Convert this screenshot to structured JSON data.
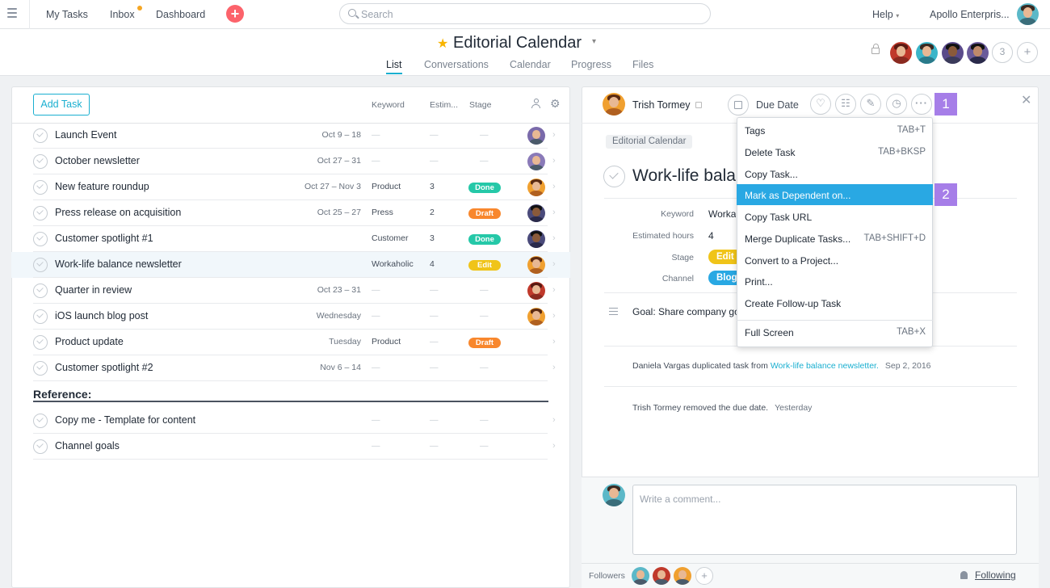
{
  "topbar": {
    "nav": [
      "My Tasks",
      "Inbox",
      "Dashboard"
    ],
    "search_placeholder": "Search",
    "help": "Help",
    "org": "Apollo Enterpris..."
  },
  "project": {
    "title": "Editorial Calendar",
    "tabs": [
      "List",
      "Conversations",
      "Calendar",
      "Progress",
      "Files"
    ],
    "member_count": "3"
  },
  "list": {
    "add_task": "Add Task",
    "columns": {
      "keyword": "Keyword",
      "estimated": "Estim...",
      "stage": "Stage"
    },
    "rows": [
      {
        "name": "Launch Event",
        "date": "Oct 9 – 18",
        "keyword": "—",
        "est": "—",
        "stage": "—",
        "stage_color": ""
      },
      {
        "name": "October newsletter",
        "date": "Oct 27 – 31",
        "keyword": "—",
        "est": "—",
        "stage": "—",
        "stage_color": ""
      },
      {
        "name": "New feature roundup",
        "date": "Oct 27 – Nov 3",
        "keyword": "Product",
        "est": "3",
        "stage": "Done",
        "stage_color": "#25c8a8"
      },
      {
        "name": "Press release on acquisition",
        "date": "Oct 25 – 27",
        "keyword": "Press",
        "est": "2",
        "stage": "Draft",
        "stage_color": "#f8872d"
      },
      {
        "name": "Customer spotlight #1",
        "date": "",
        "keyword": "Customer",
        "est": "3",
        "stage": "Done",
        "stage_color": "#25c8a8"
      },
      {
        "name": "Work-life balance newsletter",
        "date": "",
        "keyword": "Workaholic",
        "est": "4",
        "stage": "Edit",
        "stage_color": "#f0c419"
      },
      {
        "name": "Quarter in review",
        "date": "Oct 23 – 31",
        "keyword": "—",
        "est": "—",
        "stage": "—",
        "stage_color": ""
      },
      {
        "name": "iOS launch blog post",
        "date": "Wednesday",
        "keyword": "—",
        "est": "—",
        "stage": "—",
        "stage_color": ""
      },
      {
        "name": "Product update",
        "date": "Tuesday",
        "keyword": "Product",
        "est": "—",
        "stage": "Draft",
        "stage_color": "#f8872d"
      },
      {
        "name": "Customer spotlight #2",
        "date": "Nov 6 – 14",
        "keyword": "—",
        "est": "—",
        "stage": "—",
        "stage_color": ""
      }
    ],
    "reference_header": "Reference:",
    "reference_rows": [
      {
        "name": "Copy me - Template for content",
        "keyword": "—",
        "est": "—",
        "stage": "—"
      },
      {
        "name": "Channel goals",
        "keyword": "—",
        "est": "—",
        "stage": "—"
      }
    ]
  },
  "detail": {
    "assignee": "Trish Tormey",
    "due_date": "Due Date",
    "project_tag": "Editorial Calendar",
    "title": "Work-life balance newsletter",
    "fields": [
      {
        "label": "Keyword",
        "value": "Workaholic"
      },
      {
        "label": "Estimated hours",
        "value": "4"
      },
      {
        "label": "Stage",
        "value": "Edit",
        "color": "#f0c419"
      },
      {
        "label": "Channel",
        "value": "Blog",
        "color": "#29a8e3"
      }
    ],
    "description": "Goal: Share company goals",
    "stories": [
      {
        "actor": "Daniela Vargas duplicated task from",
        "link": "Work-life balance newsletter.",
        "time": "Sep 2, 2016"
      },
      {
        "actor": "Trish Tormey removed the due date.",
        "link": "",
        "time": "Yesterday"
      }
    ],
    "comment_placeholder": "Write a comment...",
    "followers_label": "Followers",
    "following": "Following"
  },
  "menu": {
    "items": [
      {
        "label": "Tags",
        "shortcut": "TAB+T"
      },
      {
        "label": "Delete Task",
        "shortcut": "TAB+BKSP"
      },
      {
        "label": "Copy Task...",
        "shortcut": ""
      },
      {
        "label": "Mark as Dependent on...",
        "shortcut": ""
      },
      {
        "label": "Copy Task URL",
        "shortcut": ""
      },
      {
        "label": "Merge Duplicate Tasks...",
        "shortcut": "TAB+SHIFT+D"
      },
      {
        "label": "Convert to a Project...",
        "shortcut": ""
      },
      {
        "label": "Print...",
        "shortcut": ""
      },
      {
        "label": "Create Follow-up Task",
        "shortcut": ""
      },
      {
        "label": "Full Screen",
        "shortcut": "TAB+X"
      }
    ],
    "highlighted_index": 3
  },
  "badges": [
    "1",
    "2"
  ],
  "colors": {
    "accent": "#1aafd0",
    "highlight": "#29a8e3",
    "badge": "#a67ee8",
    "add": "#fc636b"
  },
  "icons": [
    "menu-icon",
    "search-icon",
    "star-icon",
    "lock-icon",
    "like-icon",
    "subtask-icon",
    "attach-icon",
    "timer-icon",
    "more-icon",
    "close-icon",
    "bell-icon"
  ]
}
